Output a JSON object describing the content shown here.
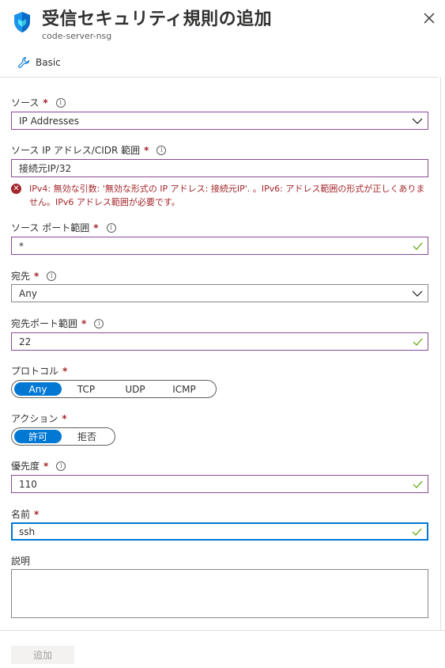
{
  "header": {
    "title": "受信セキュリティ規則の追加",
    "subtitle": "code-server-nsg",
    "icon": "shield-icon",
    "close_icon": "close-icon"
  },
  "tabs": [
    {
      "label": "Basic",
      "icon": "wrench-icon"
    }
  ],
  "form": {
    "source": {
      "label": "ソース",
      "required": "*",
      "value": "IP Addresses"
    },
    "source_ip": {
      "label": "ソース IP アドレス/CIDR 範囲",
      "required": "*",
      "value": "接続元IP/32"
    },
    "error": {
      "icon": "error-icon",
      "text": "IPv4: 無効な引数: '無効な形式の IP アドレス: 接続元IP'. 。IPv6: アドレス範囲の形式が正しくありません。IPv6 アドレス範囲が必要です。"
    },
    "source_port": {
      "label": "ソース ポート範囲",
      "required": "*",
      "value": "*"
    },
    "destination": {
      "label": "宛先",
      "required": "*",
      "value": "Any"
    },
    "dest_port": {
      "label": "宛先ポート範囲",
      "required": "*",
      "value": "22"
    },
    "protocol": {
      "label": "プロトコル",
      "required": "*",
      "options": [
        "Any",
        "TCP",
        "UDP",
        "ICMP"
      ],
      "selected": "Any"
    },
    "action": {
      "label": "アクション",
      "required": "*",
      "options": [
        "許可",
        "拒否"
      ],
      "selected": "許可"
    },
    "priority": {
      "label": "優先度",
      "required": "*",
      "value": "110"
    },
    "name": {
      "label": "名前",
      "required": "*",
      "value": "ssh"
    },
    "description": {
      "label": "説明",
      "value": ""
    }
  },
  "footer": {
    "add_label": "追加"
  },
  "colors": {
    "accent": "#0078d4",
    "error": "#a4262c",
    "valid": "#57a300",
    "invalid_border": "#8a4a96"
  }
}
